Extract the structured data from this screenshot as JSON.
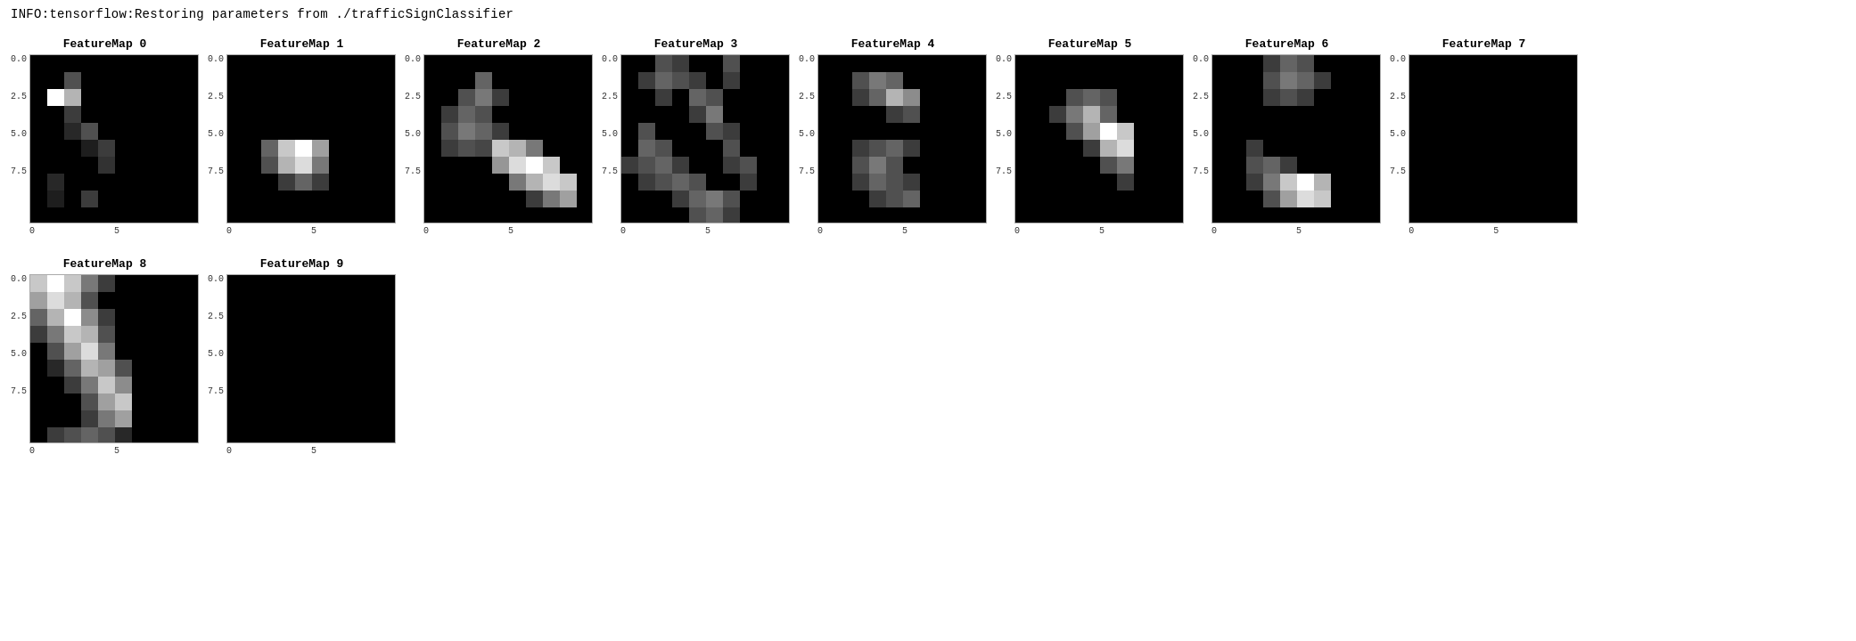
{
  "info_line": "INFO:tensorflow:Restoring parameters from ./trafficSignClassifier",
  "row1": {
    "maps": [
      {
        "title": "FeatureMap 0",
        "id": "fm0",
        "pixels": [
          [
            0,
            0,
            0,
            0,
            0,
            0,
            0,
            0,
            0,
            0
          ],
          [
            0,
            0,
            80,
            0,
            0,
            0,
            0,
            0,
            0,
            0
          ],
          [
            0,
            255,
            180,
            0,
            0,
            0,
            0,
            0,
            0,
            0
          ],
          [
            0,
            0,
            60,
            0,
            0,
            0,
            0,
            0,
            0,
            0
          ],
          [
            0,
            0,
            40,
            80,
            0,
            0,
            0,
            0,
            0,
            0
          ],
          [
            0,
            0,
            0,
            30,
            60,
            0,
            0,
            0,
            0,
            0
          ],
          [
            0,
            0,
            0,
            0,
            50,
            0,
            0,
            0,
            0,
            0
          ],
          [
            0,
            40,
            0,
            0,
            0,
            0,
            0,
            0,
            0,
            0
          ],
          [
            0,
            30,
            0,
            60,
            0,
            0,
            0,
            0,
            0,
            0
          ],
          [
            0,
            0,
            0,
            0,
            0,
            0,
            0,
            0,
            0,
            0
          ]
        ]
      },
      {
        "title": "FeatureMap 1",
        "id": "fm1",
        "pixels": [
          [
            0,
            0,
            0,
            0,
            0,
            0,
            0,
            0,
            0,
            0
          ],
          [
            0,
            0,
            0,
            0,
            0,
            0,
            0,
            0,
            0,
            0
          ],
          [
            0,
            0,
            0,
            0,
            0,
            0,
            0,
            0,
            0,
            0
          ],
          [
            0,
            0,
            0,
            0,
            0,
            0,
            0,
            0,
            0,
            0
          ],
          [
            0,
            0,
            0,
            0,
            0,
            0,
            0,
            0,
            0,
            0
          ],
          [
            0,
            0,
            100,
            200,
            255,
            160,
            0,
            0,
            0,
            0
          ],
          [
            0,
            0,
            80,
            180,
            220,
            120,
            0,
            0,
            0,
            0
          ],
          [
            0,
            0,
            0,
            60,
            100,
            60,
            0,
            0,
            0,
            0
          ],
          [
            0,
            0,
            0,
            0,
            0,
            0,
            0,
            0,
            0,
            0
          ],
          [
            0,
            0,
            0,
            0,
            0,
            0,
            0,
            0,
            0,
            0
          ]
        ]
      },
      {
        "title": "FeatureMap 2",
        "id": "fm2",
        "pixels": [
          [
            0,
            0,
            0,
            0,
            0,
            0,
            0,
            0,
            0,
            0
          ],
          [
            0,
            0,
            0,
            100,
            0,
            0,
            0,
            0,
            0,
            0
          ],
          [
            0,
            0,
            80,
            120,
            60,
            0,
            0,
            0,
            0,
            0
          ],
          [
            0,
            60,
            100,
            80,
            0,
            0,
            0,
            0,
            0,
            0
          ],
          [
            0,
            80,
            120,
            100,
            60,
            0,
            0,
            0,
            0,
            0
          ],
          [
            0,
            60,
            80,
            70,
            200,
            180,
            120,
            0,
            0,
            0
          ],
          [
            0,
            0,
            0,
            0,
            150,
            220,
            255,
            200,
            0,
            0
          ],
          [
            0,
            0,
            0,
            0,
            0,
            120,
            180,
            220,
            200,
            0
          ],
          [
            0,
            0,
            0,
            0,
            0,
            0,
            60,
            120,
            160,
            0
          ],
          [
            0,
            0,
            0,
            0,
            0,
            0,
            0,
            0,
            0,
            0
          ]
        ]
      },
      {
        "title": "FeatureMap 3",
        "id": "fm3",
        "pixels": [
          [
            0,
            0,
            80,
            60,
            0,
            0,
            80,
            0,
            0,
            0
          ],
          [
            0,
            60,
            100,
            80,
            60,
            0,
            60,
            0,
            0,
            0
          ],
          [
            0,
            0,
            60,
            0,
            100,
            80,
            0,
            0,
            0,
            0
          ],
          [
            0,
            0,
            0,
            0,
            60,
            120,
            0,
            0,
            0,
            0
          ],
          [
            0,
            80,
            0,
            0,
            0,
            80,
            60,
            0,
            0,
            0
          ],
          [
            0,
            100,
            80,
            0,
            0,
            0,
            80,
            0,
            0,
            0
          ],
          [
            60,
            80,
            100,
            60,
            0,
            0,
            60,
            80,
            0,
            0
          ],
          [
            0,
            60,
            80,
            100,
            80,
            0,
            0,
            60,
            0,
            0
          ],
          [
            0,
            0,
            0,
            60,
            100,
            120,
            80,
            0,
            0,
            0
          ],
          [
            0,
            0,
            0,
            0,
            80,
            100,
            60,
            0,
            0,
            0
          ]
        ]
      },
      {
        "title": "FeatureMap 4",
        "id": "fm4",
        "pixels": [
          [
            0,
            0,
            0,
            0,
            0,
            0,
            0,
            0,
            0,
            0
          ],
          [
            0,
            0,
            80,
            120,
            100,
            0,
            0,
            0,
            0,
            0
          ],
          [
            0,
            0,
            60,
            100,
            180,
            140,
            0,
            0,
            0,
            0
          ],
          [
            0,
            0,
            0,
            0,
            60,
            80,
            0,
            0,
            0,
            0
          ],
          [
            0,
            0,
            0,
            0,
            0,
            0,
            0,
            0,
            0,
            0
          ],
          [
            0,
            0,
            60,
            80,
            100,
            60,
            0,
            0,
            0,
            0
          ],
          [
            0,
            0,
            80,
            120,
            80,
            0,
            0,
            0,
            0,
            0
          ],
          [
            0,
            0,
            60,
            100,
            80,
            60,
            0,
            0,
            0,
            0
          ],
          [
            0,
            0,
            0,
            60,
            80,
            100,
            0,
            0,
            0,
            0
          ],
          [
            0,
            0,
            0,
            0,
            0,
            0,
            0,
            0,
            0,
            0
          ]
        ]
      },
      {
        "title": "FeatureMap 5",
        "id": "fm5",
        "pixels": [
          [
            0,
            0,
            0,
            0,
            0,
            0,
            0,
            0,
            0,
            0
          ],
          [
            0,
            0,
            0,
            0,
            0,
            0,
            0,
            0,
            0,
            0
          ],
          [
            0,
            0,
            0,
            80,
            100,
            80,
            0,
            0,
            0,
            0
          ],
          [
            0,
            0,
            60,
            120,
            180,
            100,
            0,
            0,
            0,
            0
          ],
          [
            0,
            0,
            0,
            80,
            160,
            255,
            200,
            0,
            0,
            0
          ],
          [
            0,
            0,
            0,
            0,
            60,
            180,
            220,
            0,
            0,
            0
          ],
          [
            0,
            0,
            0,
            0,
            0,
            80,
            120,
            0,
            0,
            0
          ],
          [
            0,
            0,
            0,
            0,
            0,
            0,
            60,
            0,
            0,
            0
          ],
          [
            0,
            0,
            0,
            0,
            0,
            0,
            0,
            0,
            0,
            0
          ],
          [
            0,
            0,
            0,
            0,
            0,
            0,
            0,
            0,
            0,
            0
          ]
        ]
      },
      {
        "title": "FeatureMap 6",
        "id": "fm6",
        "pixels": [
          [
            0,
            0,
            0,
            60,
            100,
            80,
            0,
            0,
            0,
            0
          ],
          [
            0,
            0,
            0,
            80,
            120,
            100,
            60,
            0,
            0,
            0
          ],
          [
            0,
            0,
            0,
            60,
            80,
            60,
            0,
            0,
            0,
            0
          ],
          [
            0,
            0,
            0,
            0,
            0,
            0,
            0,
            0,
            0,
            0
          ],
          [
            0,
            0,
            0,
            0,
            0,
            0,
            0,
            0,
            0,
            0
          ],
          [
            0,
            0,
            60,
            0,
            0,
            0,
            0,
            0,
            0,
            0
          ],
          [
            0,
            0,
            80,
            100,
            60,
            0,
            0,
            0,
            0,
            0
          ],
          [
            0,
            0,
            60,
            120,
            200,
            255,
            180,
            0,
            0,
            0
          ],
          [
            0,
            0,
            0,
            80,
            160,
            220,
            200,
            0,
            0,
            0
          ],
          [
            0,
            0,
            0,
            0,
            0,
            0,
            0,
            0,
            0,
            0
          ]
        ]
      },
      {
        "title": "FeatureMap 7",
        "id": "fm7",
        "pixels": [
          [
            0,
            0,
            0,
            0,
            0,
            0,
            0,
            0,
            0,
            0
          ],
          [
            0,
            0,
            0,
            0,
            0,
            0,
            0,
            0,
            0,
            0
          ],
          [
            0,
            0,
            0,
            0,
            0,
            0,
            0,
            0,
            0,
            0
          ],
          [
            0,
            0,
            0,
            0,
            0,
            0,
            0,
            0,
            0,
            0
          ],
          [
            0,
            0,
            0,
            0,
            0,
            0,
            0,
            0,
            0,
            0
          ],
          [
            0,
            0,
            0,
            0,
            0,
            0,
            0,
            0,
            0,
            0
          ],
          [
            0,
            0,
            0,
            0,
            0,
            0,
            0,
            0,
            0,
            0
          ],
          [
            0,
            0,
            0,
            0,
            0,
            0,
            0,
            0,
            0,
            0
          ],
          [
            0,
            0,
            0,
            0,
            0,
            0,
            0,
            0,
            0,
            0
          ],
          [
            0,
            0,
            0,
            0,
            0,
            0,
            0,
            0,
            0,
            0
          ]
        ]
      }
    ]
  },
  "row2": {
    "maps": [
      {
        "title": "FeatureMap 8",
        "id": "fm8",
        "pixels": [
          [
            200,
            255,
            200,
            120,
            60,
            0,
            0,
            0,
            0,
            0
          ],
          [
            160,
            220,
            180,
            80,
            0,
            0,
            0,
            0,
            0,
            0
          ],
          [
            100,
            180,
            255,
            140,
            60,
            0,
            0,
            0,
            0,
            0
          ],
          [
            60,
            120,
            200,
            180,
            80,
            0,
            0,
            0,
            0,
            0
          ],
          [
            0,
            80,
            160,
            220,
            120,
            0,
            0,
            0,
            0,
            0
          ],
          [
            0,
            40,
            100,
            180,
            160,
            80,
            0,
            0,
            0,
            0
          ],
          [
            0,
            0,
            60,
            120,
            200,
            140,
            0,
            0,
            0,
            0
          ],
          [
            0,
            0,
            0,
            80,
            160,
            200,
            0,
            0,
            0,
            0
          ],
          [
            0,
            0,
            0,
            60,
            120,
            160,
            0,
            0,
            0,
            0
          ],
          [
            0,
            60,
            80,
            100,
            80,
            40,
            0,
            0,
            0,
            0
          ]
        ]
      },
      {
        "title": "FeatureMap 9",
        "id": "fm9",
        "pixels": [
          [
            0,
            0,
            0,
            0,
            0,
            0,
            0,
            0,
            0,
            0
          ],
          [
            0,
            0,
            0,
            0,
            0,
            0,
            0,
            0,
            0,
            0
          ],
          [
            0,
            0,
            0,
            0,
            0,
            0,
            0,
            0,
            0,
            0
          ],
          [
            0,
            0,
            0,
            0,
            0,
            0,
            0,
            0,
            0,
            0
          ],
          [
            0,
            0,
            0,
            0,
            0,
            0,
            0,
            0,
            0,
            0
          ],
          [
            0,
            0,
            0,
            0,
            0,
            0,
            0,
            0,
            0,
            0
          ],
          [
            0,
            0,
            0,
            0,
            0,
            0,
            0,
            0,
            0,
            0
          ],
          [
            0,
            0,
            0,
            0,
            0,
            0,
            0,
            0,
            0,
            0
          ],
          [
            0,
            0,
            0,
            0,
            0,
            0,
            0,
            0,
            0,
            0
          ],
          [
            0,
            0,
            0,
            0,
            0,
            0,
            0,
            0,
            0,
            0
          ]
        ]
      }
    ]
  },
  "y_axis_labels": [
    "0.0",
    "2.5",
    "5.0",
    "7.5",
    ""
  ],
  "x_axis_labels": [
    "0",
    "5"
  ],
  "colors": {
    "background": "#ffffff",
    "text": "#000000",
    "plot_bg": "#000000"
  }
}
